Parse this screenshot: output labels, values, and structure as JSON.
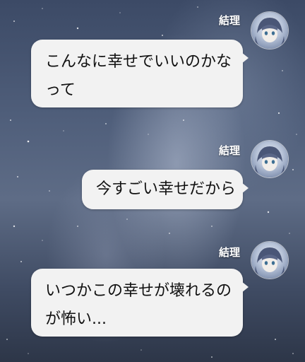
{
  "messages": [
    {
      "sender": "結理",
      "avatar_icon": "anime-girl-avatar-icon",
      "lines": [
        "こんなに幸せでいいのかな",
        "って"
      ]
    },
    {
      "sender": "結理",
      "avatar_icon": "anime-girl-avatar-icon",
      "lines": [
        "今すごい幸せだから"
      ]
    },
    {
      "sender": "結理",
      "avatar_icon": "anime-girl-avatar-icon",
      "lines": [
        "いつかこの幸せが壊れるの",
        "が怖い..."
      ]
    }
  ],
  "colors": {
    "bubble_bg": "#f2f2f2",
    "text": "#111111",
    "sender_text": "#ffffff"
  }
}
